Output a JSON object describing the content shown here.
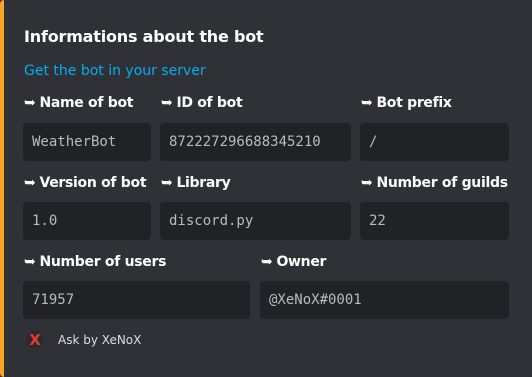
{
  "embed": {
    "title": "Informations about the bot",
    "link_text": "Get the bot in your server",
    "accent_color": "#f5a623",
    "arrow": "➥",
    "fields": [
      {
        "name": "Name of bot",
        "value": "WeatherBot"
      },
      {
        "name": "ID of bot",
        "value": "872227296688345210"
      },
      {
        "name": "Bot prefix",
        "value": "/"
      },
      {
        "name": "Version of bot",
        "value": "1.0"
      },
      {
        "name": "Library",
        "value": "discord.py"
      },
      {
        "name": "Number of guilds",
        "value": "22"
      },
      {
        "name": "Number of users",
        "value": "71957"
      },
      {
        "name": "Owner",
        "value": "@XeNoX#0001"
      }
    ],
    "footer": {
      "icon": "X",
      "text": "Ask by XeNoX"
    }
  }
}
